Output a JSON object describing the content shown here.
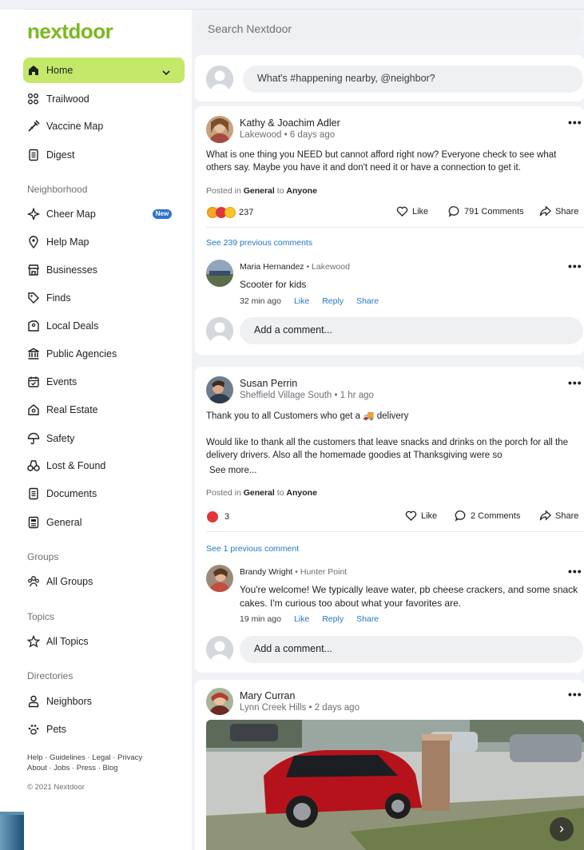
{
  "app": {
    "logo": "nextdoor"
  },
  "search": {
    "placeholder": "Search Nextdoor"
  },
  "sidebar": {
    "home": "Home",
    "items": [
      {
        "label": "Trailwood",
        "icon": "group-icon"
      },
      {
        "label": "Vaccine Map",
        "icon": "syringe-icon"
      },
      {
        "label": "Digest",
        "icon": "document-icon"
      }
    ],
    "neighborhood_heading": "Neighborhood",
    "neighborhood": [
      {
        "label": "Cheer Map",
        "icon": "sparkle-icon",
        "badge": "New"
      },
      {
        "label": "Help Map",
        "icon": "pin-icon"
      },
      {
        "label": "Businesses",
        "icon": "store-icon"
      },
      {
        "label": "Finds",
        "icon": "tag-icon"
      },
      {
        "label": "Local Deals",
        "icon": "deal-icon"
      },
      {
        "label": "Public Agencies",
        "icon": "building-icon"
      },
      {
        "label": "Events",
        "icon": "calendar-icon"
      },
      {
        "label": "Real Estate",
        "icon": "house-icon"
      },
      {
        "label": "Safety",
        "icon": "umbrella-icon"
      },
      {
        "label": "Lost & Found",
        "icon": "binoculars-icon"
      },
      {
        "label": "Documents",
        "icon": "document-icon"
      },
      {
        "label": "General",
        "icon": "newspaper-icon"
      }
    ],
    "groups_heading": "Groups",
    "groups": [
      {
        "label": "All Groups",
        "icon": "group-icon"
      }
    ],
    "topics_heading": "Topics",
    "topics": [
      {
        "label": "All Topics",
        "icon": "star-icon"
      }
    ],
    "directories_heading": "Directories",
    "directories": [
      {
        "label": "Neighbors",
        "icon": "person-icon"
      },
      {
        "label": "Pets",
        "icon": "paw-icon"
      }
    ],
    "footer_line1": "Help · Guidelines · Legal · Privacy",
    "footer_line2": "About · Jobs · Press · Blog",
    "copyright": "© 2021 Nextdoor"
  },
  "composer": {
    "placeholder": "What's #happening nearby, @neighbor?"
  },
  "posts": [
    {
      "author": "Kathy & Joachim Adler",
      "meta": "Lakewood • 6 days ago",
      "body": "What is one thing you NEED but cannot afford right now?  Everyone check to see what others say. Maybe you have it and don't need it or have a connection to get it.",
      "posted_prefix": "Posted in",
      "category": "General",
      "posted_to": "to",
      "audience": "Anyone",
      "reactions": "237",
      "like": "Like",
      "comments": "791 Comments",
      "share": "Share",
      "previous": "See 239 previous comments",
      "comment": {
        "author": "Maria Hernandez",
        "location": "• Lakewood",
        "text": "Scooter for kids",
        "time": "32 min ago",
        "like": "Like",
        "reply": "Reply",
        "share": "Share"
      },
      "add_comment": "Add a comment..."
    },
    {
      "author": "Susan Perrin",
      "meta": "Sheffield Village South • 1 hr ago",
      "body_line1": "Thank you to all Customers who get a 🚚 delivery",
      "body_line2": "Would like to thank all the customers that leave snacks and drinks on the porch for all the delivery drivers.  Also all the homemade goodies at Thanksgiving were  so",
      "see_more": "See more...",
      "posted_prefix": "Posted in",
      "category": "General",
      "posted_to": "to",
      "audience": "Anyone",
      "reactions": "3",
      "like": "Like",
      "comments": "2 Comments",
      "share": "Share",
      "previous": "See 1 previous comment",
      "comment": {
        "author": "Brandy Wright",
        "location": "• Hunter Point",
        "text": "You're welcome! We typically leave water, pb cheese crackers, and some snack cakes.  I'm curious too about what your favorites are.",
        "time": "19 min ago",
        "like": "Like",
        "reply": "Reply",
        "share": "Share"
      },
      "add_comment": "Add a comment..."
    },
    {
      "author": "Mary Curran",
      "meta": "Lynn Creek Hills • 2 days ago"
    }
  ],
  "more_label": "•••",
  "next_label": "›",
  "colors": {
    "brand": "#7bb81f",
    "home_bg": "#c3e86a",
    "link": "#1f77c8",
    "badge": "#2f74d0"
  }
}
